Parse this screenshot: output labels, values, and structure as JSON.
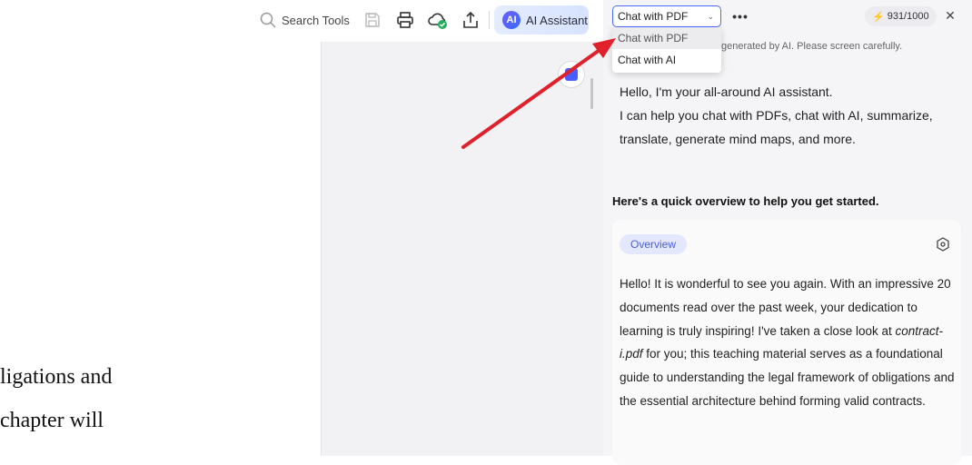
{
  "toolbar": {
    "search_label": "Search Tools",
    "ai_badge": "AI",
    "ai_button_label": "AI Assistant"
  },
  "document": {
    "line1": "ligations and",
    "line2": "chapter   will"
  },
  "ai_panel": {
    "mode_selected": "Chat with PDF",
    "mode_options": [
      "Chat with PDF",
      "Chat with AI"
    ],
    "more_glyph": "•••",
    "credits": "931/1000",
    "close_glyph": "✕",
    "disclaimer": "generated by AI. Please screen carefully.",
    "greeting_line1": "Hello, I'm your all-around AI assistant.",
    "greeting_line2": "I can help you chat with PDFs, chat with AI, summarize, translate, generate mind maps, and more.",
    "quick_overview_heading": "Here's a quick overview to help you get started.",
    "overview_tag": "Overview",
    "overview_text_before": "Hello! It is wonderful to see you again. With an impressive 20 documents read over the past week, your dedication to learning is truly inspiring! I've taken a close look at ",
    "overview_filename": "contract-i.pdf",
    "overview_text_after": " for you; this teaching material serves as a foundational guide to understanding the legal framework of obligations and the essential architecture behind forming valid contracts."
  },
  "colors": {
    "accent": "#4b6bff",
    "arrow": "#e0202a",
    "overview_tag_bg": "#e3e7ff"
  },
  "icons": [
    "search-icon",
    "save-icon",
    "print-icon",
    "cloud-sync-icon",
    "share-icon",
    "chevron-down-icon",
    "more-icon",
    "bolt-icon",
    "close-icon",
    "hexagon-settings-icon"
  ]
}
